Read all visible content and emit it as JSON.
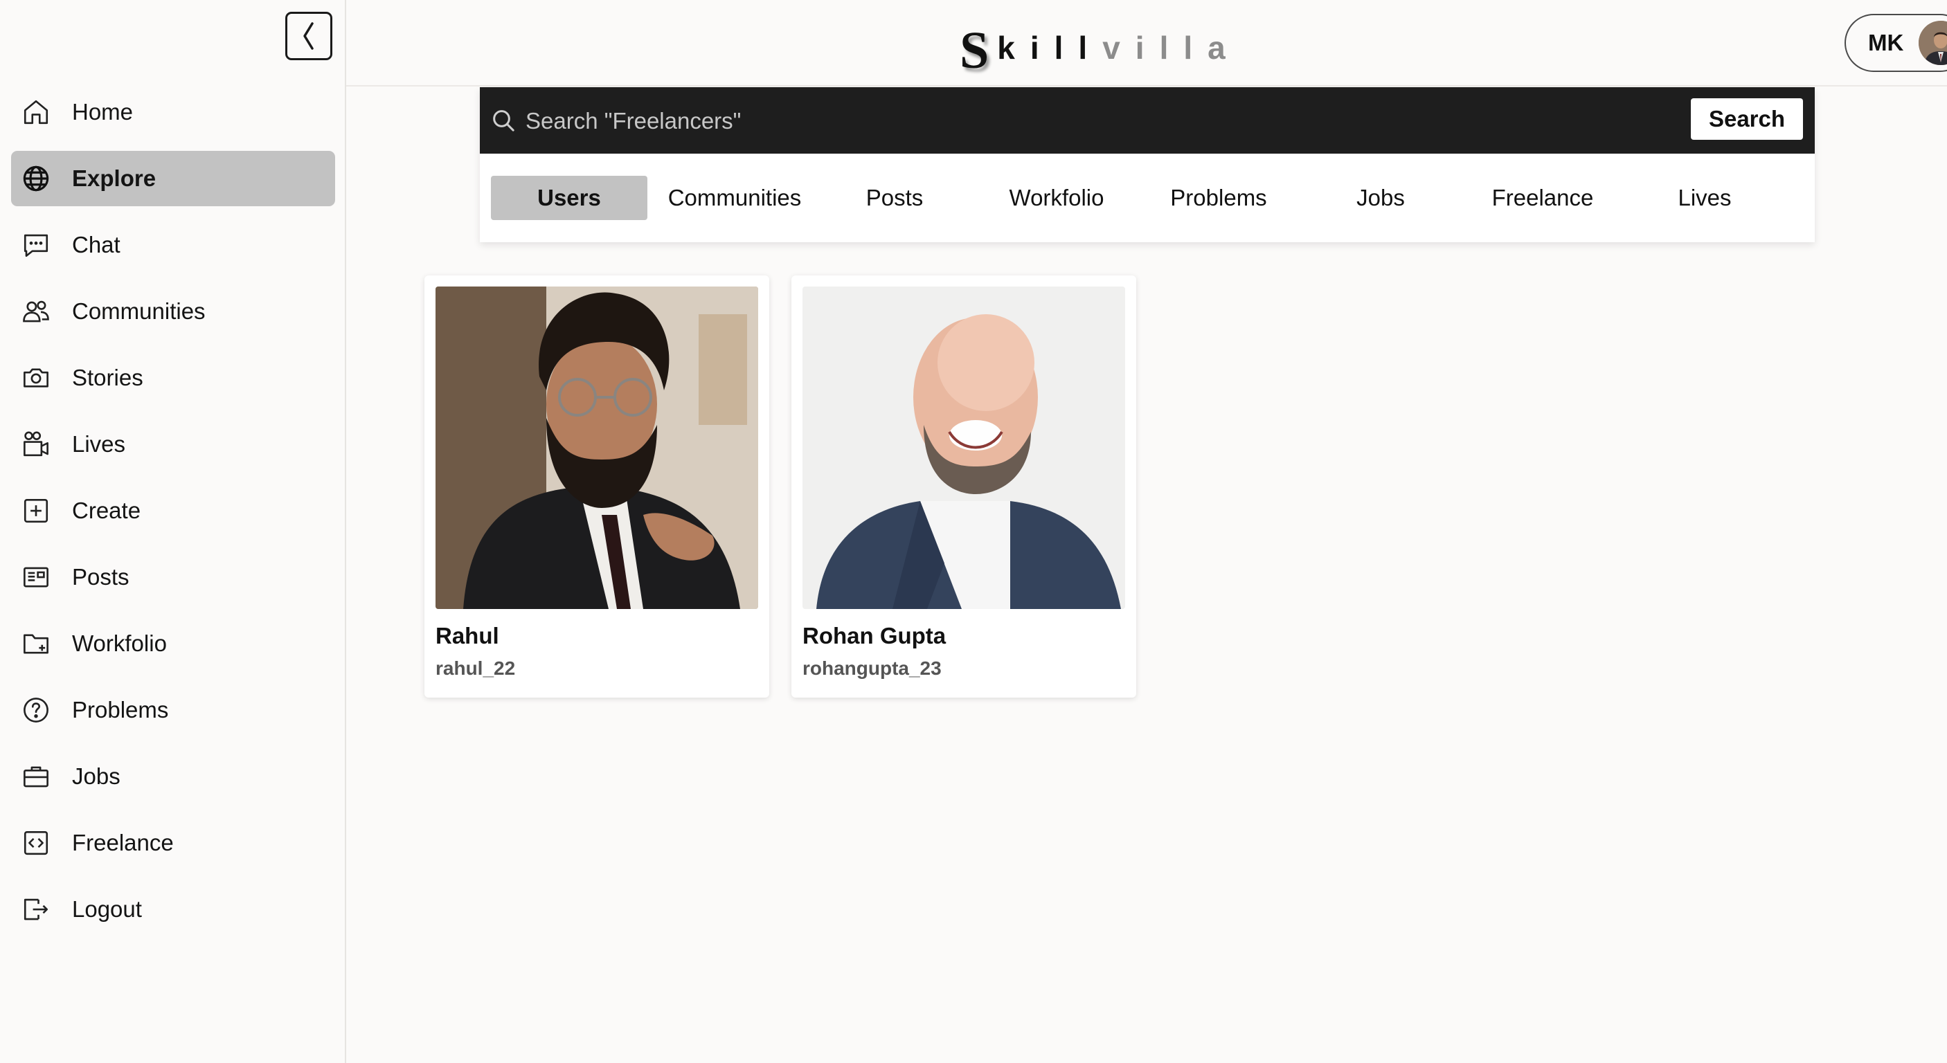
{
  "sidebar": {
    "items": [
      {
        "label": "Home",
        "icon": "home-icon"
      },
      {
        "label": "Explore",
        "icon": "globe-icon"
      },
      {
        "label": "Chat",
        "icon": "chat-icon"
      },
      {
        "label": "Communities",
        "icon": "users-icon"
      },
      {
        "label": "Stories",
        "icon": "camera-icon"
      },
      {
        "label": "Lives",
        "icon": "video-icon"
      },
      {
        "label": "Create",
        "icon": "plus-square-icon"
      },
      {
        "label": "Posts",
        "icon": "newspaper-icon"
      },
      {
        "label": "Workfolio",
        "icon": "folder-plus-icon"
      },
      {
        "label": "Problems",
        "icon": "question-circle-icon"
      },
      {
        "label": "Jobs",
        "icon": "briefcase-icon"
      },
      {
        "label": "Freelance",
        "icon": "code-square-icon"
      },
      {
        "label": "Logout",
        "icon": "logout-icon"
      }
    ],
    "active": "Explore"
  },
  "header": {
    "logo": {
      "first": "S",
      "middle": "kill",
      "end": "villa"
    },
    "profile": {
      "initials": "MK"
    }
  },
  "search": {
    "placeholder": "Search \"Freelancers\"",
    "button_label": "Search"
  },
  "tabs": {
    "items": [
      "Users",
      "Communities",
      "Posts",
      "Workfolio",
      "Problems",
      "Jobs",
      "Freelance",
      "Lives"
    ],
    "active": "Users"
  },
  "results": [
    {
      "name": "Rahul",
      "handle": "rahul_22"
    },
    {
      "name": "Rohan Gupta",
      "handle": "rohangupta_23"
    }
  ],
  "colors": {
    "active_bg": "#c2c2c2",
    "search_bar_bg": "#1e1e1e",
    "page_bg": "#fbfaf9"
  }
}
